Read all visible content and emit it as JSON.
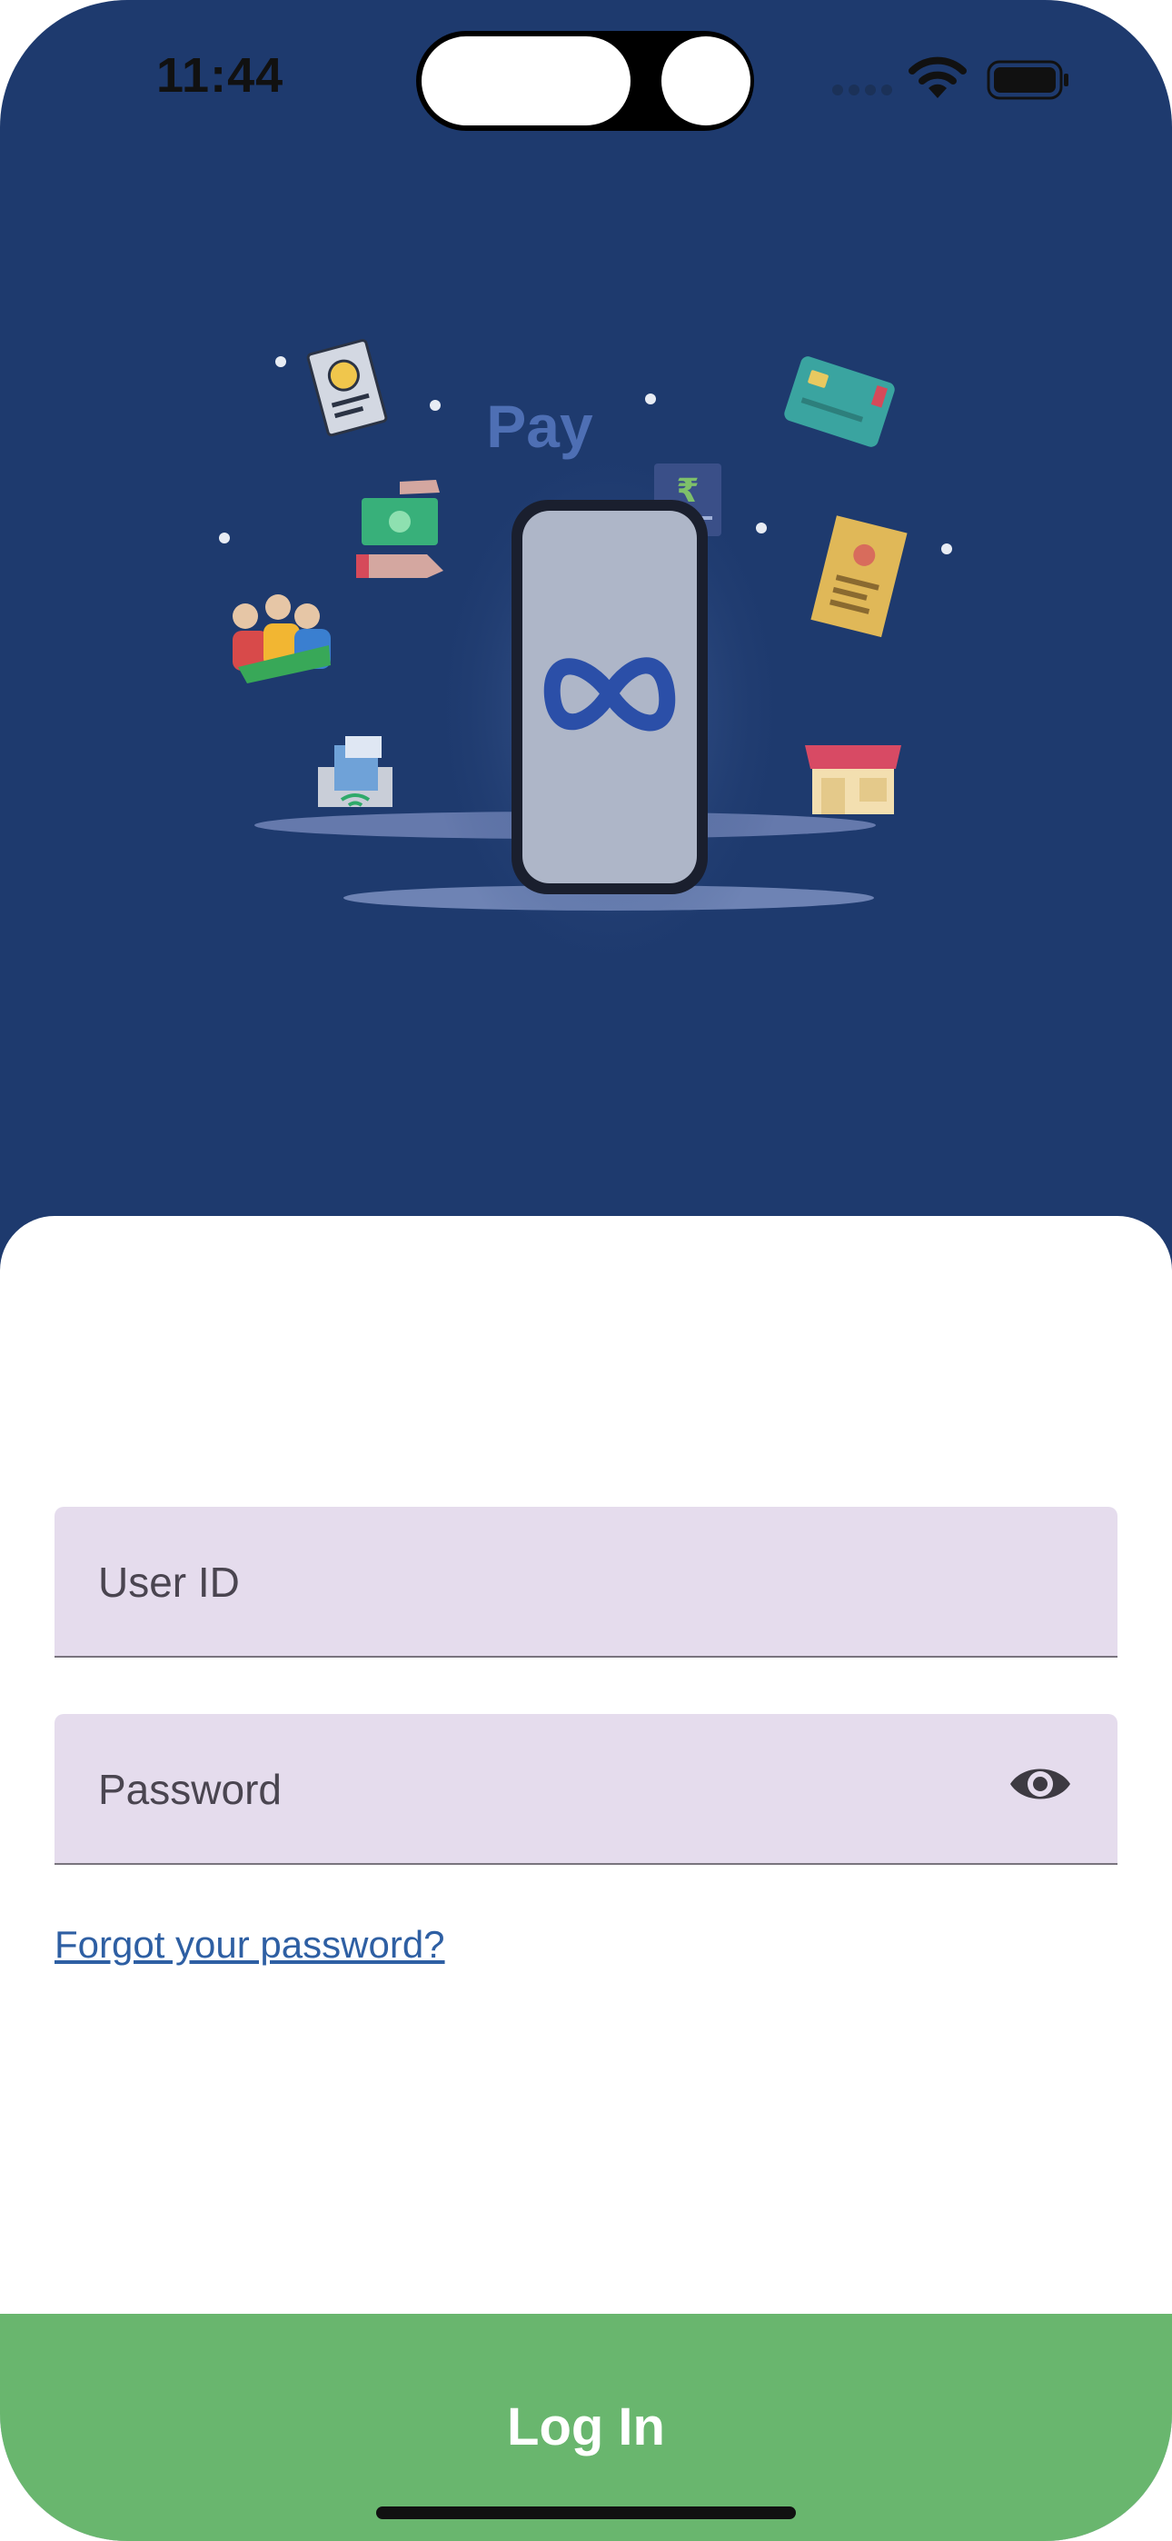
{
  "status_bar": {
    "time": "11:44",
    "icons": [
      "cellular-dots-icon",
      "wifi-icon",
      "battery-icon"
    ]
  },
  "hero": {
    "pay_text": "Pay",
    "rupee_symbol": "₹",
    "illustration_icons": [
      "rupee-receipt-icon",
      "money-handoff-icon",
      "group-of-people-icon",
      "bank-card-icon",
      "id-document-icon",
      "pos-terminal-icon",
      "storefront-icon",
      "infinity-logo-icon"
    ]
  },
  "form": {
    "user_id_label": "User ID",
    "password_label": "Password",
    "password_toggle_icon": "eye-icon",
    "forgot_link": "Forgot your password?"
  },
  "footer": {
    "login_label": "Log In"
  },
  "colors": {
    "hero_background": "#1e3a6e",
    "field_background": "#e5dced",
    "link": "#2e5fa3",
    "login_button": "#69b66e"
  }
}
